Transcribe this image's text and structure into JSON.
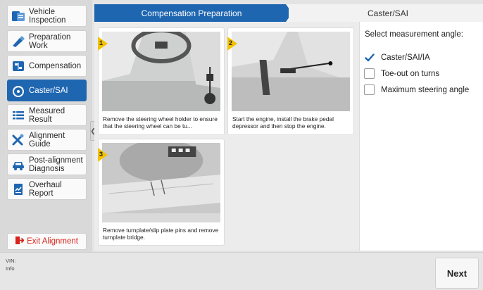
{
  "sidebar": {
    "items": [
      {
        "label_1": "Vehicle",
        "label_2": "Inspection",
        "icon": "vehicle-inspection-icon"
      },
      {
        "label_1": "Preparation",
        "label_2": "Work",
        "icon": "preparation-work-icon"
      },
      {
        "label_1": "Compensation",
        "label_2": "",
        "icon": "compensation-icon"
      },
      {
        "label_1": "Caster/SAI",
        "label_2": "",
        "icon": "caster-sai-icon",
        "active": true
      },
      {
        "label_1": "Measured",
        "label_2": "Result",
        "icon": "measured-result-icon"
      },
      {
        "label_1": "Alignment",
        "label_2": "Guide",
        "icon": "alignment-guide-icon"
      },
      {
        "label_1": "Post-alignment",
        "label_2": "Diagnosis",
        "icon": "post-alignment-diagnosis-icon"
      },
      {
        "label_1": "Overhaul Report",
        "label_2": "",
        "icon": "overhaul-report-icon"
      }
    ],
    "exit_label": "Exit Alignment",
    "collapse_glyph": "❮"
  },
  "header": {
    "active_tab": "Compensation Preparation",
    "next_tab": "Caster/SAI"
  },
  "steps": [
    {
      "number": "1",
      "caption": "Remove the steering wheel holder to ensure that the steering wheel can be tu..."
    },
    {
      "number": "2",
      "caption": "Start the engine, install the brake pedal depressor and then stop the engine."
    },
    {
      "number": "3",
      "caption": "Remove turnplate/slip plate pins and remove turnplate bridge."
    }
  ],
  "options_panel": {
    "title": "Select measurement angle:",
    "options": [
      {
        "label": "Caster/SAI/IA",
        "checked": true
      },
      {
        "label": "Toe-out on turns",
        "checked": false
      },
      {
        "label": "Maximum steering angle",
        "checked": false
      }
    ]
  },
  "footer": {
    "vin_label": "VIN:",
    "info_label": "Info",
    "next_label": "Next"
  },
  "colors": {
    "accent": "#1f66b1",
    "exit_red": "#d8231c",
    "step_badge": "#f2c200"
  }
}
